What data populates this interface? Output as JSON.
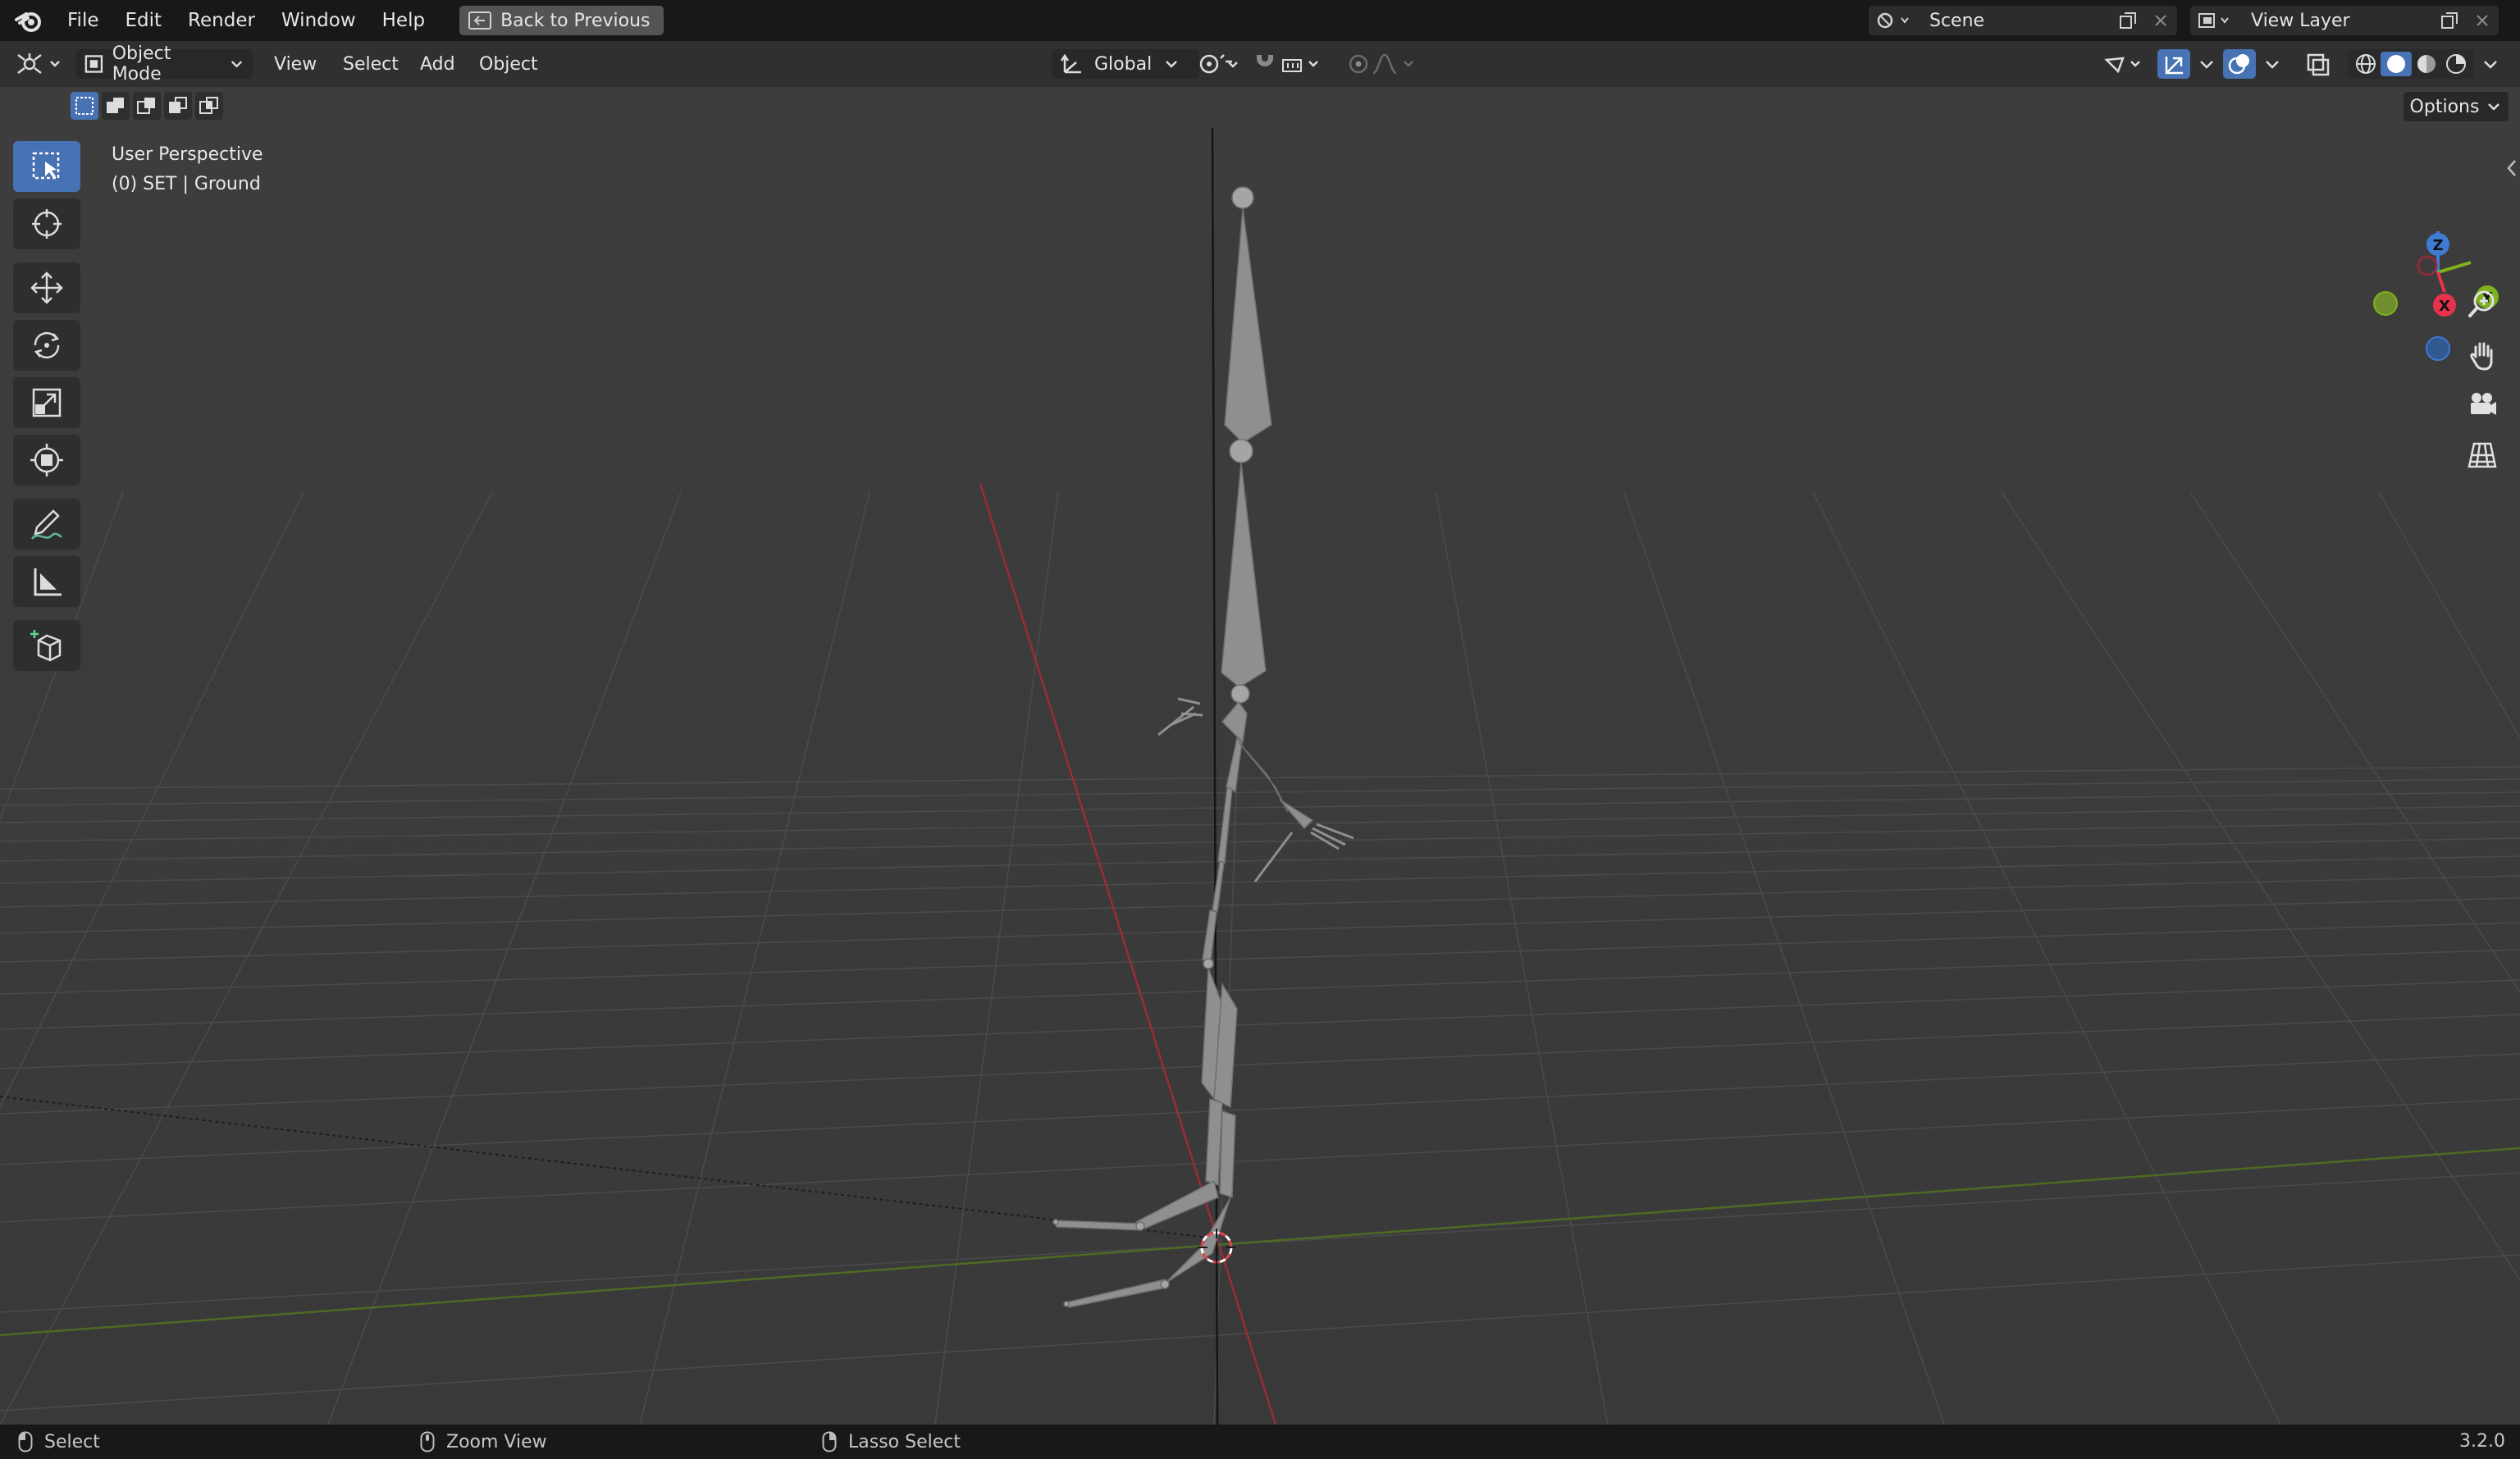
{
  "topbar": {
    "menus": [
      "File",
      "Edit",
      "Render",
      "Window",
      "Help"
    ],
    "back_label": "Back to Previous",
    "scene_name": "Scene",
    "view_layer_name": "View Layer"
  },
  "header": {
    "mode": "Object Mode",
    "menus": [
      "View",
      "Select",
      "Add",
      "Object"
    ],
    "orientation": "Global",
    "options_label": "Options"
  },
  "viewport": {
    "view_name": "User Perspective",
    "object_info": "(0) SET | Ground",
    "gizmo_axes": [
      "Z",
      "Y",
      "X"
    ]
  },
  "statusbar": {
    "left_click": "Select",
    "middle_click": "Zoom View",
    "right_click": "Lasso Select",
    "version": "3.2.0"
  },
  "colors": {
    "accent": "#4772b3",
    "axis_x": "#e8324b",
    "axis_y": "#7fb11d",
    "axis_z": "#3e7bd2"
  }
}
